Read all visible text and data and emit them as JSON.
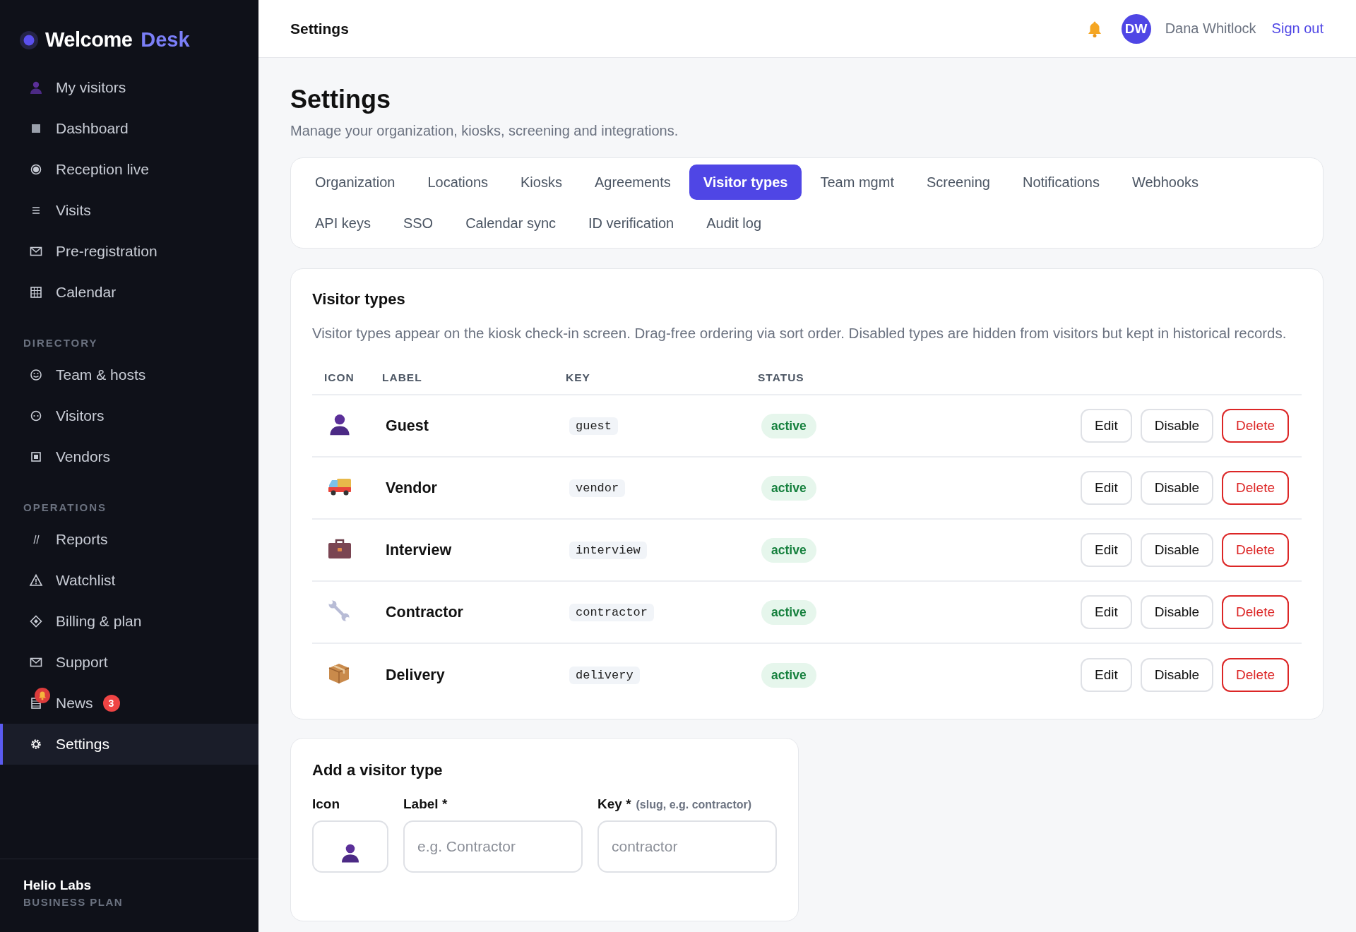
{
  "sidebar": {
    "brand": {
      "name": "Welcome",
      "accent": "Desk"
    },
    "sections": [
      {
        "items": [
          {
            "label": "My visitors",
            "selected": false,
            "alert": false
          },
          {
            "label": "Dashboard",
            "selected": false,
            "alert": false
          },
          {
            "label": "Reception live",
            "selected": false,
            "alert": false
          },
          {
            "label": "Visits",
            "selected": false,
            "alert": false
          },
          {
            "label": "Pre-registration",
            "selected": false,
            "alert": false
          },
          {
            "label": "Calendar",
            "selected": false,
            "alert": false
          }
        ]
      },
      {
        "heading": "DIRECTORY",
        "items": [
          {
            "label": "Team & hosts",
            "selected": false,
            "alert": false
          },
          {
            "label": "Visitors",
            "selected": false,
            "alert": false
          },
          {
            "label": "Vendors",
            "selected": false,
            "alert": false
          }
        ]
      },
      {
        "heading": "OPERATIONS",
        "items": [
          {
            "label": "Reports",
            "selected": false,
            "alert": false
          },
          {
            "label": "Watchlist",
            "selected": false,
            "alert": false
          },
          {
            "label": "Billing & plan",
            "selected": false,
            "alert": false
          },
          {
            "label": "Support",
            "selected": false,
            "alert": false
          },
          {
            "label": "News",
            "selected": false,
            "alert": true,
            "badge": "3"
          },
          {
            "label": "Settings",
            "selected": true,
            "alert": false
          }
        ]
      }
    ],
    "workspace": {
      "name": "Helio Labs",
      "plan": "BUSINESS PLAN"
    }
  },
  "header": {
    "title": "Settings",
    "user": {
      "initials": "DW",
      "name": "Dana Whitlock"
    },
    "sign_out": "Sign out"
  },
  "page": {
    "title": "Settings",
    "subtitle": "Manage your organization, kiosks, screening and integrations."
  },
  "tab_rows": [
    [
      {
        "label": "Organization",
        "selected": false
      },
      {
        "label": "Locations",
        "selected": false
      },
      {
        "label": "Kiosks",
        "selected": false
      },
      {
        "label": "Agreements",
        "selected": false
      },
      {
        "label": "Visitor types",
        "selected": true
      },
      {
        "label": "Team mgmt",
        "selected": false
      },
      {
        "label": "Screening",
        "selected": false
      },
      {
        "label": "Notifications",
        "selected": false
      },
      {
        "label": "Webhooks",
        "selected": false
      }
    ],
    [
      {
        "label": "API keys",
        "selected": false
      },
      {
        "label": "SSO",
        "selected": false
      },
      {
        "label": "Calendar sync",
        "selected": false
      },
      {
        "label": "ID verification",
        "selected": false
      },
      {
        "label": "Audit log",
        "selected": false
      }
    ]
  ],
  "visitor_types": {
    "title": "Visitor types",
    "description": "Visitor types appear on the kiosk check-in screen. Drag-free ordering via sort order. Disabled types are hidden from visitors but kept in historical records.",
    "columns": [
      "ICON",
      "LABEL",
      "KEY",
      "STATUS"
    ],
    "rows": [
      {
        "label": "Guest",
        "key": "guest",
        "status": "active",
        "actions": [
          "Edit",
          "Disable",
          "Delete"
        ]
      },
      {
        "label": "Vendor",
        "key": "vendor",
        "status": "active",
        "actions": [
          "Edit",
          "Disable",
          "Delete"
        ]
      },
      {
        "label": "Interview",
        "key": "interview",
        "status": "active",
        "actions": [
          "Edit",
          "Disable",
          "Delete"
        ]
      },
      {
        "label": "Contractor",
        "key": "contractor",
        "status": "active",
        "actions": [
          "Edit",
          "Disable",
          "Delete"
        ]
      },
      {
        "label": "Delivery",
        "key": "delivery",
        "status": "active",
        "actions": [
          "Edit",
          "Disable",
          "Delete"
        ]
      }
    ]
  },
  "add_form": {
    "title": "Add a visitor type",
    "icon_label": "Icon",
    "label_field": {
      "label": "Label *",
      "placeholder": "e.g. Contractor"
    },
    "key_field": {
      "label": "Key *",
      "hint": "(slug, e.g. contractor)",
      "placeholder": "contractor"
    }
  }
}
